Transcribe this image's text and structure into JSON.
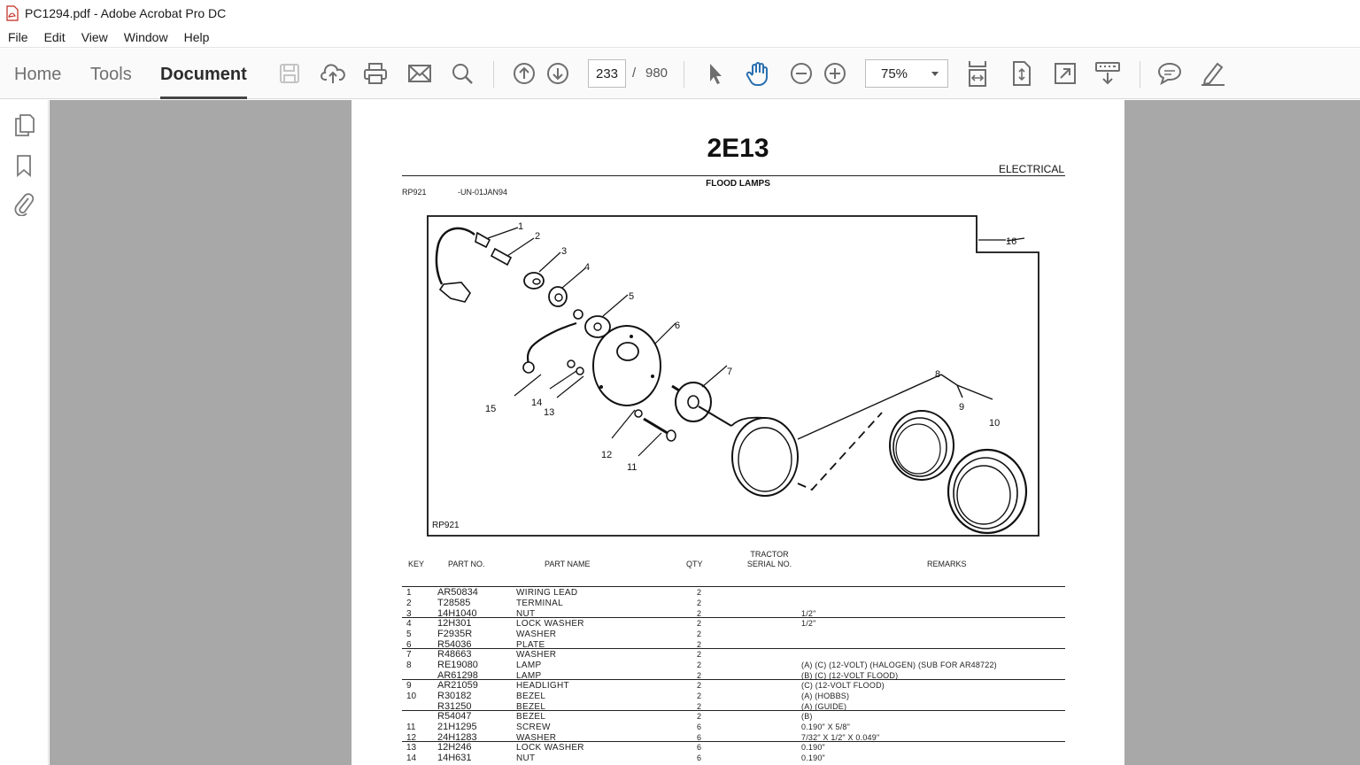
{
  "window": {
    "title": "PC1294.pdf - Adobe Acrobat Pro DC"
  },
  "menu": [
    "File",
    "Edit",
    "View",
    "Window",
    "Help"
  ],
  "toolbar": {
    "tabs": [
      "Home",
      "Tools",
      "Document"
    ],
    "active_tab": "Document",
    "page_current": "233",
    "page_separator": "/",
    "page_total": "980",
    "zoom": "75%"
  },
  "colors": {
    "doc_background": "#a8a8a8",
    "accent_blue": "#2a6fb0",
    "icon_gray": "#6e6e6e"
  },
  "document": {
    "header": "2E13",
    "section": "ELECTRICAL",
    "subtitle": "FLOOD LAMPS",
    "ref_code": "RP921",
    "ref_date": "-UN-01JAN94",
    "figure_label": "RP921",
    "callouts": [
      "1",
      "2",
      "3",
      "4",
      "5",
      "6",
      "7",
      "8",
      "9",
      "10",
      "11",
      "12",
      "13",
      "14",
      "15",
      "16"
    ],
    "table_headers": {
      "key": "KEY",
      "part_no": "PART NO.",
      "part_name": "PART NAME",
      "qty": "QTY",
      "serial_line1": "TRACTOR",
      "serial_line2": "SERIAL NO.",
      "remarks": "REMARKS"
    },
    "rows": [
      {
        "key": "1",
        "part": "AR50834",
        "name": "WIRING LEAD",
        "qty": "2",
        "remarks": ""
      },
      {
        "key": "2",
        "part": "T28585",
        "name": "TERMINAL",
        "qty": "2",
        "remarks": ""
      },
      {
        "key": "3",
        "part": "14H1040",
        "name": "NUT",
        "qty": "2",
        "remarks": "1/2\""
      },
      {
        "key": "4",
        "part": "12H301",
        "name": "LOCK WASHER",
        "qty": "2",
        "remarks": "1/2\""
      },
      {
        "key": "5",
        "part": "F2935R",
        "name": "WASHER",
        "qty": "2",
        "remarks": ""
      },
      {
        "key": "6",
        "part": "R54036",
        "name": "PLATE",
        "qty": "2",
        "remarks": ""
      },
      {
        "key": "7",
        "part": "R48663",
        "name": "WASHER",
        "qty": "2",
        "remarks": ""
      },
      {
        "key": "8",
        "part": "RE19080",
        "name": "LAMP",
        "qty": "2",
        "remarks": "(A) (C) (12-VOLT) (HALOGEN) (SUB FOR AR48722)"
      },
      {
        "key": "",
        "part": "AR61298",
        "name": "LAMP",
        "qty": "2",
        "remarks": "(B) (C) (12-VOLT FLOOD)"
      },
      {
        "key": "9",
        "part": "AR21059",
        "name": "HEADLIGHT",
        "qty": "2",
        "remarks": "(C) (12-VOLT FLOOD)"
      },
      {
        "key": "10",
        "part": "R30182",
        "name": "BEZEL",
        "qty": "2",
        "remarks": "(A) (HOBBS)"
      },
      {
        "key": "",
        "part": "R31250",
        "name": "BEZEL",
        "qty": "2",
        "remarks": "(A) (GUIDE)"
      },
      {
        "key": "",
        "part": "R54047",
        "name": "BEZEL",
        "qty": "2",
        "remarks": "(B)"
      },
      {
        "key": "11",
        "part": "21H1295",
        "name": "SCREW",
        "qty": "6",
        "remarks": "0.190\" X 5/8\""
      },
      {
        "key": "12",
        "part": "24H1283",
        "name": "WASHER",
        "qty": "6",
        "remarks": "7/32\" X 1/2\" X 0.049\""
      },
      {
        "key": "13",
        "part": "12H246",
        "name": "LOCK WASHER",
        "qty": "6",
        "remarks": "0.190\""
      },
      {
        "key": "14",
        "part": "14H631",
        "name": "NUT",
        "qty": "6",
        "remarks": "0.190\""
      }
    ]
  }
}
